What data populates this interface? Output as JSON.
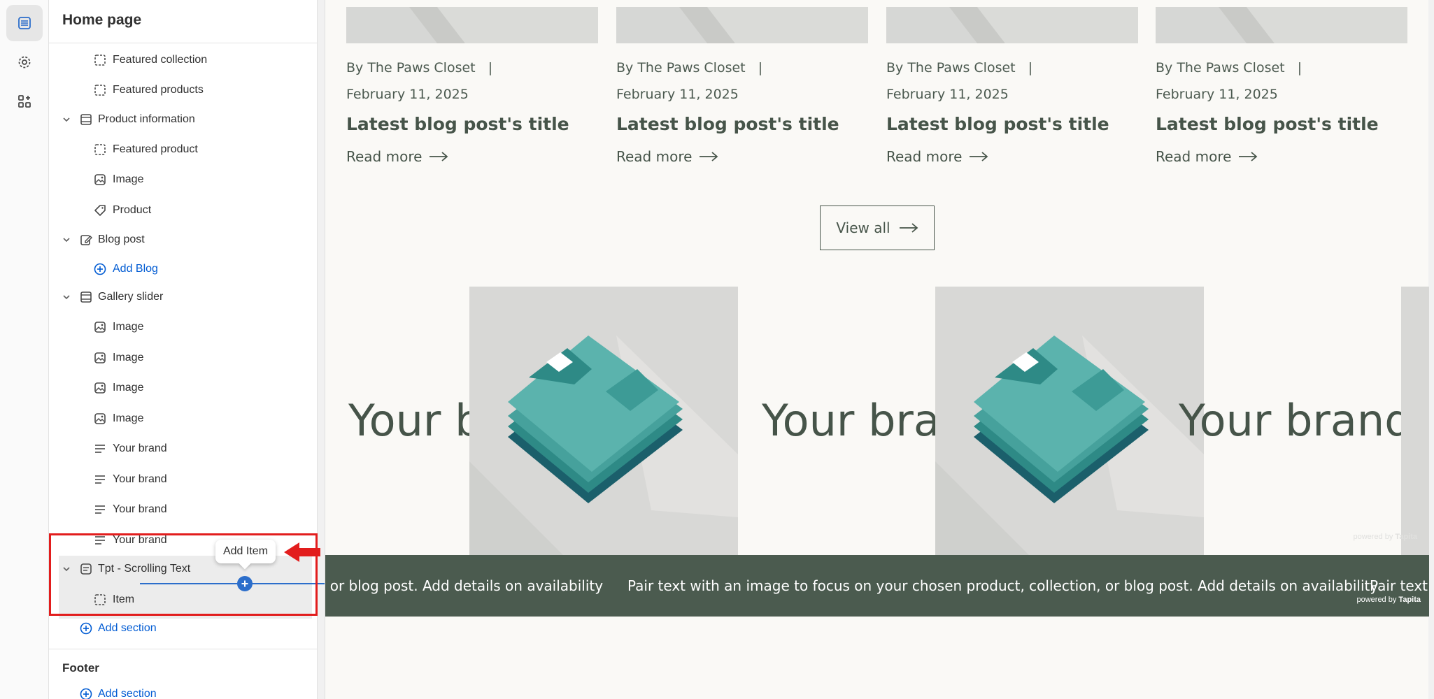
{
  "sidebar": {
    "title": "Home page",
    "rows": [
      {
        "label": "Featured collection",
        "icon": "block-icon"
      },
      {
        "label": "Featured products",
        "icon": "block-icon"
      },
      {
        "label": "Product information",
        "icon": "section-icon"
      },
      {
        "label": "Featured product",
        "icon": "block-icon"
      },
      {
        "label": "Image",
        "icon": "image-icon"
      },
      {
        "label": "Product",
        "icon": "tag-icon"
      },
      {
        "label": "Blog post",
        "icon": "edit-icon"
      },
      {
        "label": "Add Blog",
        "icon": "plus-circle-icon"
      },
      {
        "label": "Gallery slider",
        "icon": "section-icon"
      },
      {
        "label": "Image",
        "icon": "image-icon"
      },
      {
        "label": "Image",
        "icon": "image-icon"
      },
      {
        "label": "Image",
        "icon": "image-icon"
      },
      {
        "label": "Image",
        "icon": "image-icon"
      },
      {
        "label": "Your brand",
        "icon": "text-icon"
      },
      {
        "label": "Your brand",
        "icon": "text-icon"
      },
      {
        "label": "Your brand",
        "icon": "text-icon"
      },
      {
        "label": "Your brand",
        "icon": "text-icon"
      },
      {
        "label": "Tpt - Scrolling Text",
        "icon": "text-block-icon"
      },
      {
        "label": "Item",
        "icon": "block-icon"
      },
      {
        "label": "Add section",
        "icon": "plus-circle-icon"
      }
    ],
    "tooltip": "Add Item",
    "footer_title": "Footer",
    "footer_add": "Add section"
  },
  "preview": {
    "posts": [
      {
        "author": "By The Paws Closet",
        "separator": "|",
        "date": "February 11, 2025",
        "title": "Latest blog post's title",
        "read_more": "Read more"
      },
      {
        "author": "By The Paws Closet",
        "separator": "|",
        "date": "February 11, 2025",
        "title": "Latest blog post's title",
        "read_more": "Read more"
      },
      {
        "author": "By The Paws Closet",
        "separator": "|",
        "date": "February 11, 2025",
        "title": "Latest blog post's title",
        "read_more": "Read more"
      },
      {
        "author": "By The Paws Closet",
        "separator": "|",
        "date": "February 11, 2025",
        "title": "Latest blog post's title",
        "read_more": "Read more"
      }
    ],
    "view_all": "View all",
    "gallery_text": "Your brand",
    "marquee_text": "Pair text with an image to focus on your chosen product, collection, or blog post. Add details on availability",
    "marquee_partial_left": ", or blog post. Add details on availability",
    "marquee_partial_right": "Pair text",
    "powered_prefix": "powered by",
    "powered_brand": "Tapita"
  },
  "colors": {
    "accent": "#005bd3",
    "annotation_red": "#e21d1d",
    "brand_green": "#4b5b4f",
    "shirt_teal": "#5bb3ad"
  }
}
